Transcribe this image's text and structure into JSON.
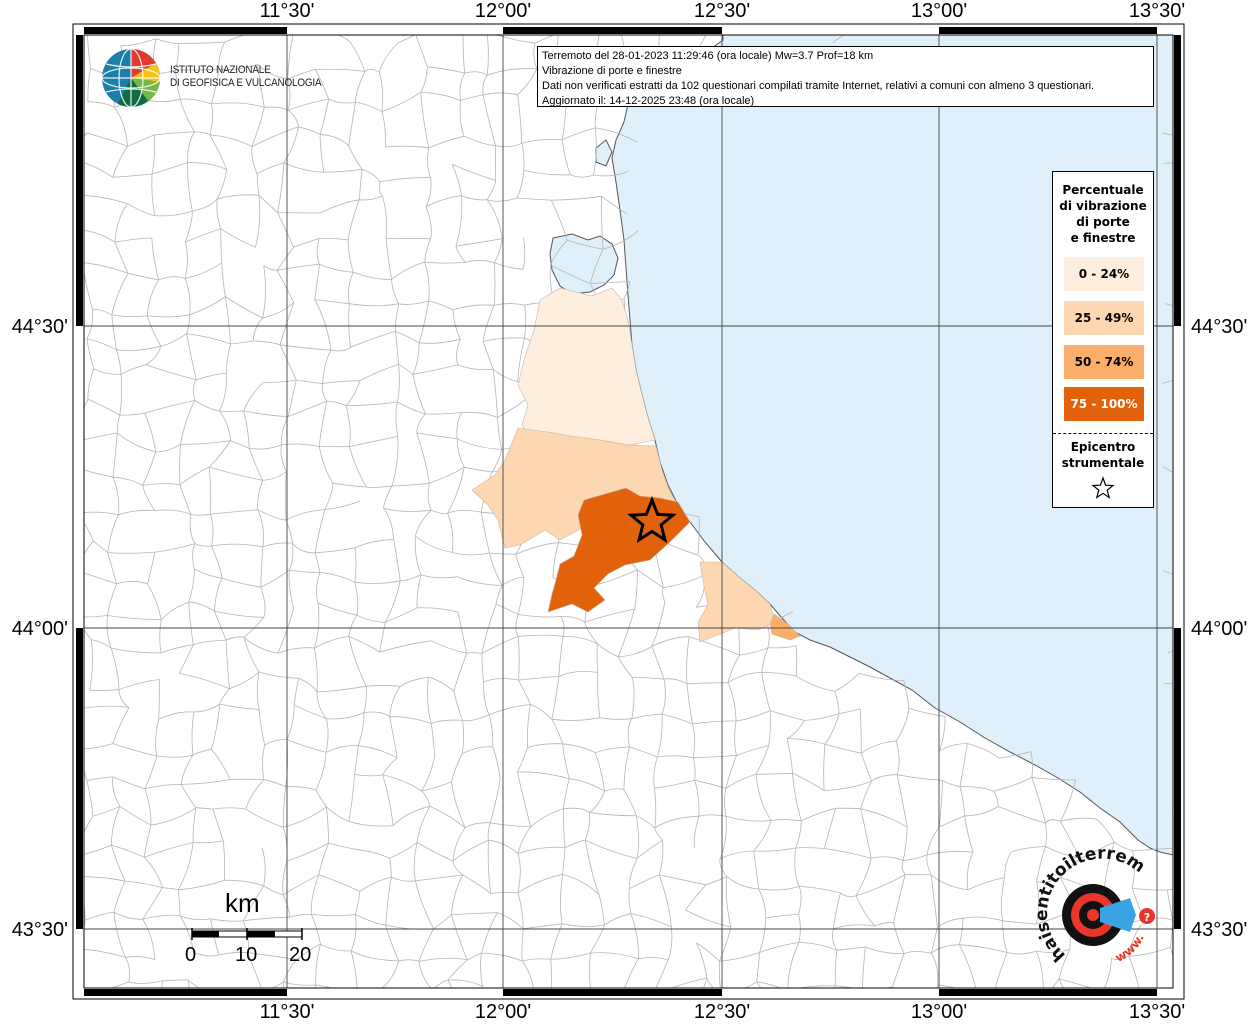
{
  "info": {
    "line1": "Terremoto del 28-01-2023 11:29:46 (ora locale) Mw=3.7 Prof=18 km",
    "line2": "Vibrazione di porte e finestre",
    "line3": "Dati non verificati estratti da 102 questionari compilati tramite Internet, relativi a comuni con almeno 3 questionari.",
    "line4": "Aggiornato il: 14-12-2025 23:48 (ora locale)"
  },
  "logo": {
    "line1": "ISTITUTO NAZIONALE",
    "line2": "DI GEOFISICA E VULCANOLOGIA"
  },
  "axes": {
    "lon_labels": [
      "11°30'",
      "12°00'",
      "12°30'",
      "13°00'",
      "13°30'"
    ],
    "lat_labels": [
      "44°30'",
      "44°00'",
      "43°30'"
    ]
  },
  "legend": {
    "title": [
      "Percentuale",
      "di vibrazione",
      "di porte",
      "e finestre"
    ],
    "classes": [
      {
        "label": "0 - 24%",
        "color": "#fdeedd"
      },
      {
        "label": "25 - 49%",
        "color": "#fdd6b2"
      },
      {
        "label": "50 - 74%",
        "color": "#fbae69"
      },
      {
        "label": "75 - 100%",
        "color": "#e2620b"
      }
    ],
    "epicenter_label": [
      "Epicentro",
      "strumentale"
    ]
  },
  "scale": {
    "unit": "km",
    "ticks": [
      "0",
      "10",
      "20"
    ]
  },
  "colors": {
    "sea": "#dff0fb",
    "land": "#ffffff",
    "borders": "#aaaaaa"
  },
  "icons": {
    "epicenter": "star-icon",
    "hsit_logo": "haisentitoilterremoto-logo",
    "ingv_logo": "ingv-globe-logo"
  },
  "watermark": {
    "text": "haisentitoilterremoto.it",
    "prefix": "www."
  }
}
